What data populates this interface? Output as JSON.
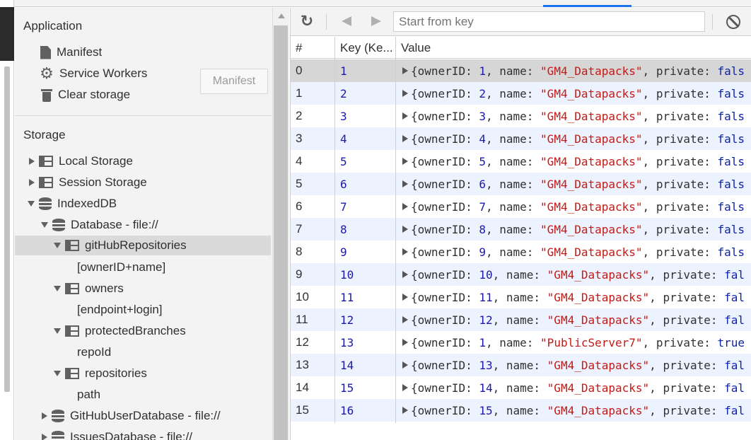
{
  "sidebar": {
    "application": {
      "title": "Application",
      "items": [
        {
          "label": "Manifest",
          "icon": "file-icon"
        },
        {
          "label": "Service Workers",
          "icon": "gear-icon"
        },
        {
          "label": "Clear storage",
          "icon": "trash-icon"
        }
      ]
    },
    "manifest_button": "Manifest",
    "storage": {
      "title": "Storage",
      "local_storage": "Local Storage",
      "session_storage": "Session Storage",
      "indexeddb": "IndexedDB",
      "database": "Database - file://",
      "stores": [
        {
          "name": "gitHubRepositories",
          "index": "[ownerID+name]"
        },
        {
          "name": "owners",
          "index": "[endpoint+login]"
        },
        {
          "name": "protectedBranches",
          "index": "repoId"
        },
        {
          "name": "repositories",
          "index": "path"
        }
      ],
      "github_user_db": "GitHubUserDatabase - file://",
      "issues_db": "IssuesDatabase - file://"
    }
  },
  "toolbar": {
    "search_placeholder": "Start from key"
  },
  "grid": {
    "headers": {
      "index": "#",
      "key": "Key (Ke...",
      "value": "Value"
    },
    "rows": [
      {
        "idx": "0",
        "key": "1",
        "owner": "1",
        "name": "\"GM4_Datapacks\"",
        "priv": "fals"
      },
      {
        "idx": "1",
        "key": "2",
        "owner": "2",
        "name": "\"GM4_Datapacks\"",
        "priv": "fals"
      },
      {
        "idx": "2",
        "key": "3",
        "owner": "3",
        "name": "\"GM4_Datapacks\"",
        "priv": "fals"
      },
      {
        "idx": "3",
        "key": "4",
        "owner": "4",
        "name": "\"GM4_Datapacks\"",
        "priv": "fals"
      },
      {
        "idx": "4",
        "key": "5",
        "owner": "5",
        "name": "\"GM4_Datapacks\"",
        "priv": "fals"
      },
      {
        "idx": "5",
        "key": "6",
        "owner": "6",
        "name": "\"GM4_Datapacks\"",
        "priv": "fals"
      },
      {
        "idx": "6",
        "key": "7",
        "owner": "7",
        "name": "\"GM4_Datapacks\"",
        "priv": "fals"
      },
      {
        "idx": "7",
        "key": "8",
        "owner": "8",
        "name": "\"GM4_Datapacks\"",
        "priv": "fals"
      },
      {
        "idx": "8",
        "key": "9",
        "owner": "9",
        "name": "\"GM4_Datapacks\"",
        "priv": "fals"
      },
      {
        "idx": "9",
        "key": "10",
        "owner": "10",
        "name": "\"GM4_Datapacks\"",
        "priv": "fal"
      },
      {
        "idx": "10",
        "key": "11",
        "owner": "11",
        "name": "\"GM4_Datapacks\"",
        "priv": "fal"
      },
      {
        "idx": "11",
        "key": "12",
        "owner": "12",
        "name": "\"GM4_Datapacks\"",
        "priv": "fal"
      },
      {
        "idx": "12",
        "key": "13",
        "owner": "1",
        "name": "\"PublicServer7\"",
        "priv": "true"
      },
      {
        "idx": "13",
        "key": "14",
        "owner": "13",
        "name": "\"GM4_Datapacks\"",
        "priv": "fal"
      },
      {
        "idx": "14",
        "key": "15",
        "owner": "14",
        "name": "\"GM4_Datapacks\"",
        "priv": "fal"
      },
      {
        "idx": "15",
        "key": "16",
        "owner": "15",
        "name": "\"GM4_Datapacks\"",
        "priv": "fal"
      }
    ],
    "prop_owner": "ownerID",
    "prop_name": "name",
    "prop_private": "private"
  }
}
